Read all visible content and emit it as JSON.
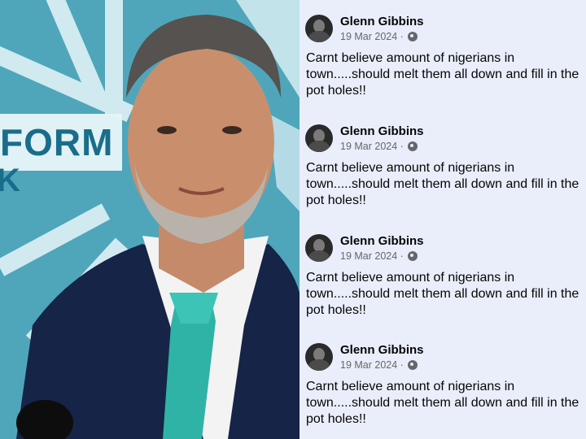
{
  "photo": {
    "banner_text_1": "FORM",
    "banner_text_2": "K"
  },
  "posts": [
    {
      "author": "Glenn Gibbins",
      "date": "19 Mar 2024",
      "separator": "·",
      "text": "Carnt believe amount of nigerians in town.....should melt them all down and fill in the pot  holes!!"
    },
    {
      "author": "Glenn Gibbins",
      "date": "19 Mar 2024",
      "separator": "·",
      "text": "Carnt believe amount of nigerians in town.....should melt them all down and fill in the pot  holes!!"
    },
    {
      "author": "Glenn Gibbins",
      "date": "19 Mar 2024",
      "separator": "·",
      "text": "Carnt believe amount of nigerians in town.....should melt them all down and fill in the pot  holes!!"
    },
    {
      "author": "Glenn Gibbins",
      "date": "19 Mar 2024",
      "separator": "·",
      "text": "Carnt believe amount of nigerians in town.....should melt them all down and fill in the pot  holes!!"
    }
  ],
  "colors": {
    "feed_bg": "#e9eefa",
    "banner": "#4fa6bb",
    "tie": "#2fb3a6",
    "suit": "#162447"
  },
  "icons": {
    "privacy": "globe-icon",
    "avatar": "profile-photo"
  }
}
